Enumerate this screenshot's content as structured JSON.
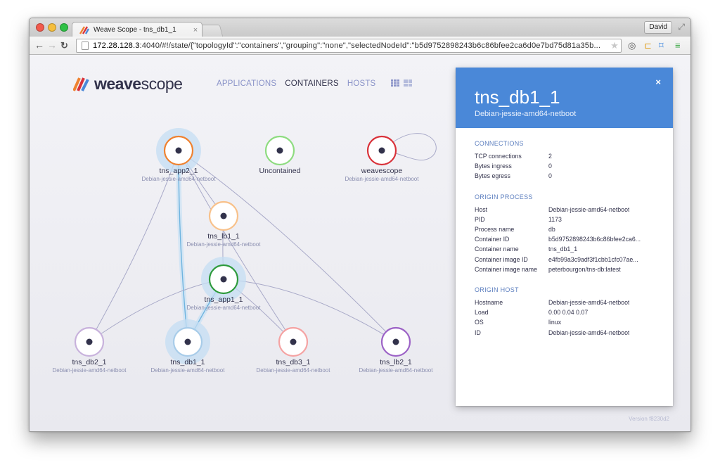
{
  "browser": {
    "tab_title": "Weave Scope - tns_db1_1",
    "tab_close": "×",
    "user_button": "David",
    "url_host": "172.28.128.3",
    "url_rest": ":4040/#!/state/{\"topologyId\":\"containers\",\"grouping\":\"none\",\"selectedNodeId\":\"b5d9752898243b6c86bfee2ca6d0e7bd75d81a35b...",
    "icons": [
      "back-icon",
      "forward-icon",
      "reload-icon",
      "star-icon",
      "menu-icon"
    ]
  },
  "app": {
    "logo_bold": "weave",
    "logo_light": "scope",
    "nav": [
      {
        "label": "APPLICATIONS",
        "active": false
      },
      {
        "label": "CONTAINERS",
        "active": true
      },
      {
        "label": "HOSTS",
        "active": false
      }
    ],
    "version": "Version f8230d2"
  },
  "graph": {
    "nodes": [
      {
        "id": "tns_app2_1",
        "name": "tns_app2_1",
        "sub": "Debian-jessie-amd64-netboot",
        "color": "#ef8230",
        "highlight": true
      },
      {
        "id": "uncontained",
        "name": "Uncontained",
        "sub": "",
        "color": "#8edc80",
        "highlight": false
      },
      {
        "id": "weavescope",
        "name": "weavescope",
        "sub": "Debian-jessie-amd64-netboot",
        "color": "#d9323a",
        "highlight": false
      },
      {
        "id": "tns_lb1_1",
        "name": "tns_lb1_1",
        "sub": "Debian-jessie-amd64-netboot",
        "color": "#f8c18a",
        "highlight": false
      },
      {
        "id": "tns_app1_1",
        "name": "tns_app1_1",
        "sub": "Debian-jessie-amd64-netboot",
        "color": "#2e9b3c",
        "highlight": true
      },
      {
        "id": "tns_db2_1",
        "name": "tns_db2_1",
        "sub": "Debian-jessie-amd64-netboot",
        "color": "#c8b2dc",
        "highlight": false
      },
      {
        "id": "tns_db1_1",
        "name": "tns_db1_1",
        "sub": "Debian-jessie-amd64-netboot",
        "color": "#a8cce9",
        "highlight": true
      },
      {
        "id": "tns_db3_1",
        "name": "tns_db3_1",
        "sub": "Debian-jessie-amd64-netboot",
        "color": "#f5a3a3",
        "highlight": false
      },
      {
        "id": "tns_lb2_1",
        "name": "tns_lb2_1",
        "sub": "Debian-jessie-amd64-netboot",
        "color": "#9c62c6",
        "highlight": false
      }
    ],
    "edges": [
      [
        "tns_app2_1",
        "tns_lb1_1"
      ],
      [
        "tns_app2_1",
        "tns_db2_1"
      ],
      [
        "tns_app2_1",
        "tns_db1_1"
      ],
      [
        "tns_app2_1",
        "tns_db3_1"
      ],
      [
        "tns_app2_1",
        "tns_lb2_1"
      ],
      [
        "tns_lb1_1",
        "tns_app1_1"
      ],
      [
        "tns_app1_1",
        "tns_db2_1"
      ],
      [
        "tns_app1_1",
        "tns_db1_1"
      ],
      [
        "tns_app1_1",
        "tns_db3_1"
      ],
      [
        "tns_app1_1",
        "tns_lb2_1"
      ],
      [
        "weavescope",
        "weavescope"
      ]
    ]
  },
  "details": {
    "title": "tns_db1_1",
    "subtitle": "Debian-jessie-amd64-netboot",
    "close": "×",
    "sections": [
      {
        "title": "CONNECTIONS",
        "rows": [
          {
            "key": "TCP connections",
            "value": "2"
          },
          {
            "key": "Bytes ingress",
            "value": "0"
          },
          {
            "key": "Bytes egress",
            "value": "0"
          }
        ]
      },
      {
        "title": "ORIGIN PROCESS",
        "rows": [
          {
            "key": "Host",
            "value": "Debian-jessie-amd64-netboot"
          },
          {
            "key": "PID",
            "value": "1173"
          },
          {
            "key": "Process name",
            "value": "db"
          },
          {
            "key": "Container ID",
            "value": "b5d9752898243b6c86bfee2ca6..."
          },
          {
            "key": "Container name",
            "value": "tns_db1_1"
          },
          {
            "key": "Container image ID",
            "value": "e4fb99a3c9adf3f1cbb1cfc07ae..."
          },
          {
            "key": "Container image name",
            "value": "peterbourgon/tns-db:latest"
          }
        ]
      },
      {
        "title": "ORIGIN HOST",
        "rows": [
          {
            "key": "Hostname",
            "value": "Debian-jessie-amd64-netboot"
          },
          {
            "key": "Load",
            "value": "0.00 0.04 0.07"
          },
          {
            "key": "OS",
            "value": "linux"
          },
          {
            "key": "ID",
            "value": "Debian-jessie-amd64-netboot"
          }
        ]
      }
    ]
  }
}
